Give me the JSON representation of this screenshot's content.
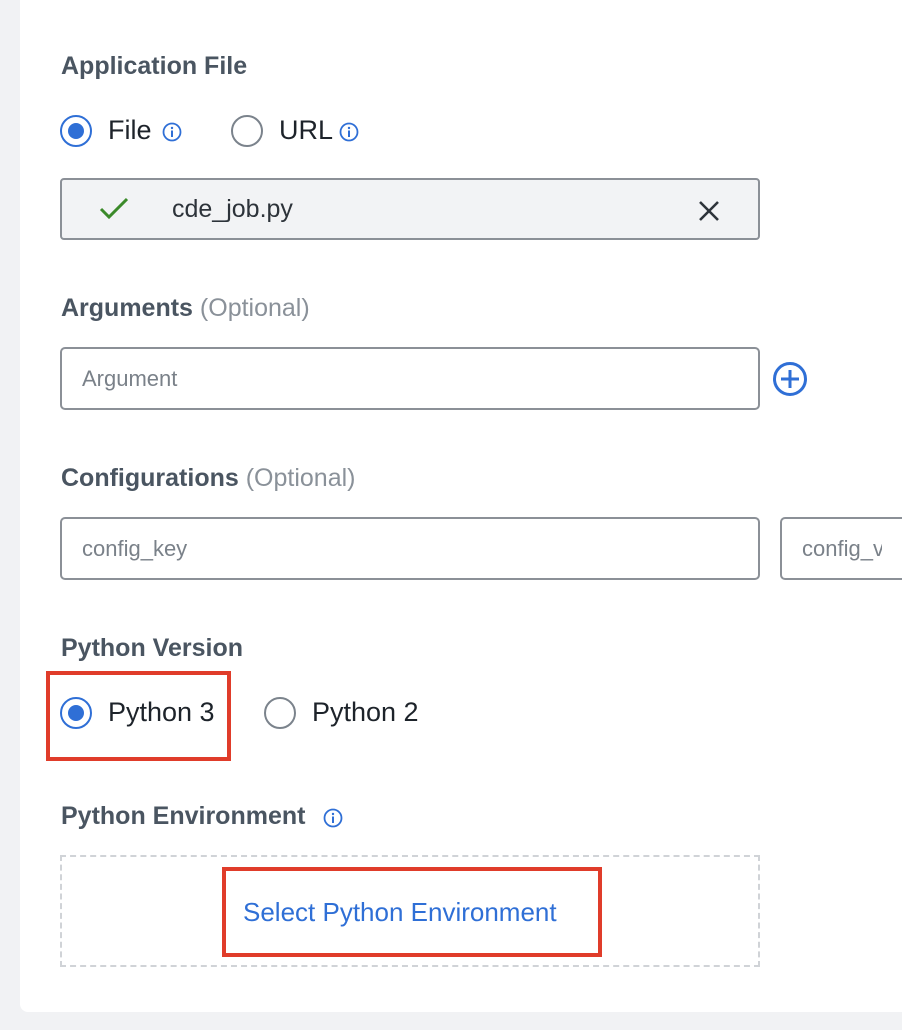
{
  "application_file": {
    "title": "Application File",
    "options": [
      {
        "label": "File",
        "selected": true,
        "info_icon": "info-icon"
      },
      {
        "label": "URL",
        "selected": false,
        "info_icon": "info-icon"
      }
    ],
    "uploaded_file": {
      "name": "cde_job.py",
      "status_icon": "check-icon",
      "remove_icon": "close-icon"
    }
  },
  "arguments": {
    "title": "Arguments",
    "optional_label": "(Optional)",
    "placeholder": "Argument",
    "value": "",
    "add_icon": "plus-circle-icon"
  },
  "configurations": {
    "title": "Configurations",
    "optional_label": "(Optional)",
    "key_placeholder": "config_key",
    "value_placeholder": "config_value",
    "key_value": "",
    "value_value": ""
  },
  "python_version": {
    "title": "Python Version",
    "options": [
      {
        "label": "Python 3",
        "selected": true
      },
      {
        "label": "Python 2",
        "selected": false
      }
    ]
  },
  "python_environment": {
    "title": "Python Environment",
    "info_icon": "info-icon",
    "select_link": "Select Python Environment"
  },
  "colors": {
    "accent": "#2f6fd6",
    "highlight": "#e03c2a",
    "success": "#3b8a2a",
    "heading": "#4a5561"
  }
}
